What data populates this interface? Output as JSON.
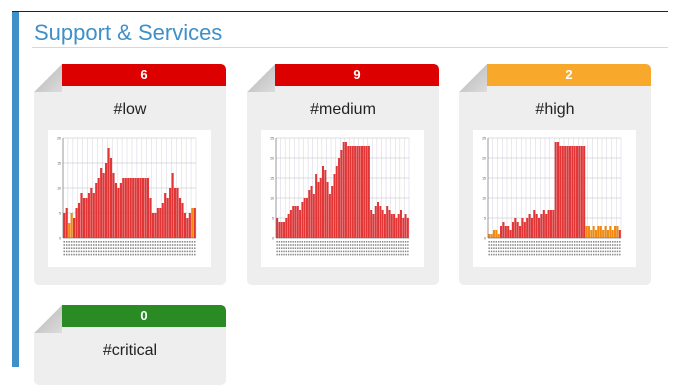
{
  "page": {
    "title": "Support & Services"
  },
  "colors": {
    "accent": "#3f8fc8",
    "red": "#dd0000",
    "orange": "#f8a92b",
    "green": "#2a8a24",
    "bar_red": "#e23535",
    "bar_orange": "#f28a0f"
  },
  "cards": [
    {
      "tag": "#low",
      "count": "6",
      "badge_color": "#dd0000",
      "chart_data": {
        "type": "bar",
        "ylim": [
          0,
          20
        ],
        "ytick_labels": [
          "0",
          "5",
          "10",
          "15",
          "20"
        ],
        "values": [
          5,
          6,
          3,
          5,
          4,
          6,
          7,
          9,
          8,
          8,
          9,
          10,
          9,
          11,
          12,
          14,
          13,
          15,
          18,
          16,
          13,
          11,
          10,
          11,
          12,
          12,
          12,
          12,
          12,
          12,
          12,
          12,
          12,
          12,
          12,
          8,
          5,
          5,
          6,
          6,
          7,
          9,
          8,
          10,
          13,
          10,
          10,
          8,
          7,
          5,
          4,
          5,
          6,
          6
        ],
        "orange_indices": [
          2,
          3,
          52
        ]
      }
    },
    {
      "tag": "#medium",
      "count": "9",
      "badge_color": "#dd0000",
      "chart_data": {
        "type": "bar",
        "ylim": [
          0,
          25
        ],
        "ytick_labels": [
          "0",
          "5",
          "10",
          "15",
          "20",
          "25"
        ],
        "values": [
          5,
          4,
          4,
          4,
          5,
          6,
          7,
          8,
          8,
          8,
          7,
          9,
          10,
          10,
          12,
          13,
          11,
          16,
          14,
          15,
          18,
          17,
          14,
          11,
          13,
          16,
          18,
          20,
          22,
          24,
          24,
          23,
          23,
          23,
          23,
          23,
          23,
          23,
          23,
          23,
          23,
          7,
          6,
          8,
          9,
          8,
          7,
          6,
          8,
          7,
          6,
          6,
          5,
          6,
          7,
          5,
          6,
          5
        ],
        "orange_indices": []
      }
    },
    {
      "tag": "#high",
      "count": "2",
      "badge_color": "#f8a92b",
      "chart_data": {
        "type": "bar",
        "ylim": [
          0,
          25
        ],
        "ytick_labels": [
          "0",
          "5",
          "10",
          "15",
          "20",
          "25"
        ],
        "values": [
          1,
          1,
          2,
          2,
          1,
          3,
          4,
          3,
          3,
          2,
          4,
          5,
          4,
          3,
          5,
          4,
          5,
          6,
          5,
          7,
          6,
          5,
          6,
          7,
          6,
          7,
          7,
          7,
          24,
          24,
          23,
          23,
          23,
          23,
          23,
          23,
          23,
          23,
          23,
          23,
          23,
          3,
          3,
          2,
          3,
          2,
          3,
          3,
          2,
          3,
          2,
          3,
          2,
          3,
          3,
          2
        ],
        "orange_indices": [
          0,
          1,
          2,
          3,
          4,
          41,
          42,
          43,
          44,
          45,
          46,
          47,
          48,
          49,
          50,
          51,
          52,
          53,
          54
        ]
      }
    },
    {
      "tag": "#critical",
      "count": "0",
      "badge_color": "#2a8a24",
      "chart_data": null
    }
  ]
}
